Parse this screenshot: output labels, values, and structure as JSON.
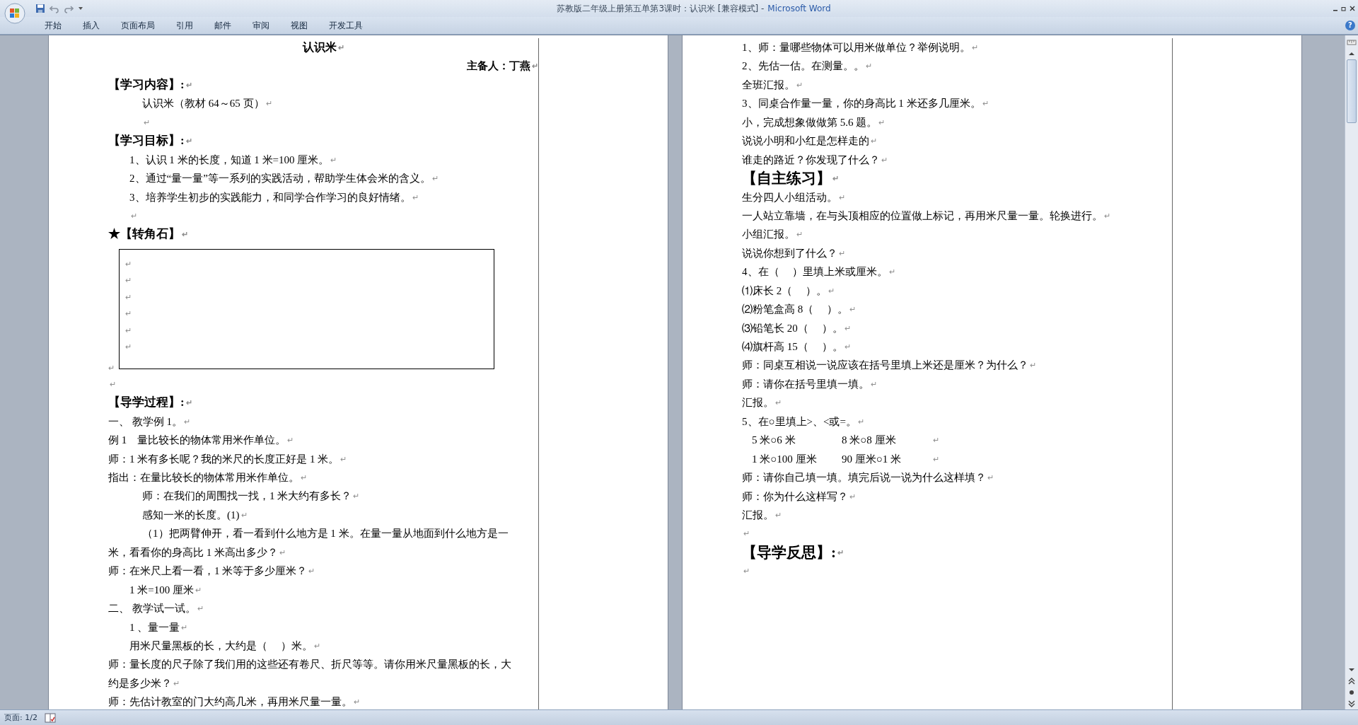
{
  "window": {
    "title": "苏教版二年级上册第五单第3课时：认识米 [兼容模式] -",
    "app": "Microsoft Word"
  },
  "ribbon_tabs": [
    {
      "label": "开始",
      "selected": false
    },
    {
      "label": "插入",
      "selected": false
    },
    {
      "label": "页面布局",
      "selected": false
    },
    {
      "label": "引用",
      "selected": false
    },
    {
      "label": "邮件",
      "selected": false
    },
    {
      "label": "审阅",
      "selected": false
    },
    {
      "label": "视图",
      "selected": false
    },
    {
      "label": "开发工具",
      "selected": false
    }
  ],
  "help": "?",
  "pages": [
    {
      "lines": [
        {
          "kind": "title",
          "text": "认识米",
          "mark": "↵"
        },
        {
          "kind": "author",
          "text": "主备人：丁燕",
          "mark": "↵"
        },
        {
          "kind": "heading",
          "text": "【学习内容】:",
          "mark": "↵"
        },
        {
          "kind": "indent",
          "text": "认识米（教材 64～65 页）",
          "mark": "↵"
        },
        {
          "kind": "indent",
          "mark": "↵"
        },
        {
          "kind": "heading",
          "text": "【学习目标】:",
          "mark": "↵"
        },
        {
          "kind": "item",
          "text": "1、认识 1 米的长度，知道 1 米=100 厘米。",
          "mark": "↵"
        },
        {
          "kind": "item",
          "text": "2、通过“量一量”等一系列的实践活动，帮助学生体会米的含义。",
          "mark": "↵"
        },
        {
          "kind": "item",
          "text": "3、培养学生初步的实践能力，和同学合作学习的良好情绪。",
          "mark": "↵"
        },
        {
          "kind": "item",
          "mark": "↵"
        },
        {
          "kind": "heading",
          "text": "★【转角石】",
          "mark": "↵"
        },
        {
          "kind": "box",
          "marks": [
            "↵",
            "↵",
            "↵",
            "↵",
            "↵",
            "↵"
          ],
          "mark": "↵"
        },
        {
          "kind": "text",
          "mark": "↵"
        },
        {
          "kind": "heading",
          "text": "【导学过程】:",
          "mark": "↵"
        },
        {
          "kind": "text",
          "text": "一、 教学例 1。",
          "mark": "↵"
        },
        {
          "kind": "text",
          "text": "例 1　量比较长的物体常用米作单位。",
          "mark": "↵"
        },
        {
          "kind": "text",
          "text": "师：1 米有多长呢？我的米尺的长度正好是 1 米。",
          "mark": "↵"
        },
        {
          "kind": "text",
          "text": "指出：在量比较长的物体常用米作单位。",
          "mark": "↵"
        },
        {
          "kind": "indent",
          "text": "师：在我们的周围找一找，1 米大约有多长？",
          "mark": "↵"
        },
        {
          "kind": "indent",
          "text": "感知一米的长度。(1)",
          "mark": "↵"
        },
        {
          "kind": "indent",
          "text": "（1）把两臂伸开，看一看到什么地方是 1 米。在量一量从地面到什么地方是一"
        },
        {
          "kind": "text",
          "text": "米，看看你的身高比 1 米高出多少？",
          "mark": "↵"
        },
        {
          "kind": "text",
          "text": "师：在米尺上看一看，1 米等于多少厘米？",
          "mark": "↵"
        },
        {
          "kind": "item",
          "text": "1 米=100 厘米",
          "mark": "↵"
        },
        {
          "kind": "text",
          "text": "二、 教学试一试。",
          "mark": "↵"
        },
        {
          "kind": "item",
          "text": "1 、量一量",
          "mark": "↵"
        },
        {
          "kind": "item",
          "text": "用米尺量黑板的长，大约是（　 ）米。",
          "mark": "↵"
        },
        {
          "kind": "text",
          "text": "师：量长度的尺子除了我们用的这些还有卷尺、折尺等等。请你用米尺量黑板的长，大"
        },
        {
          "kind": "text",
          "text": "约是多少米？",
          "mark": "↵"
        },
        {
          "kind": "text",
          "text": "师：先估计教室的门大约高几米，再用米尺量一量。",
          "mark": "↵"
        }
      ]
    },
    {
      "lines": [
        {
          "kind": "text",
          "text": "1、师：量哪些物体可以用米做单位？举例说明。",
          "mark": "↵"
        },
        {
          "kind": "text",
          "text": "2、先估一估。在测量。。",
          "mark": "↵"
        },
        {
          "kind": "text",
          "text": "全班汇报。",
          "mark": "↵"
        },
        {
          "kind": "text",
          "text": "3、同桌合作量一量，你的身高比 1 米还多几厘米。",
          "mark": "↵"
        },
        {
          "kind": "text",
          "text": "小，完成想象做做第 5.6 题。",
          "mark": "↵"
        },
        {
          "kind": "text",
          "text": "说说小明和小红是怎样走的",
          "mark": "↵"
        },
        {
          "kind": "text",
          "text": "谁走的路近？你发现了什么？",
          "mark": "↵"
        },
        {
          "kind": "big",
          "text": "【自主练习】",
          "mark": "↵"
        },
        {
          "kind": "text",
          "text": "生分四人小组活动。",
          "mark": "↵"
        },
        {
          "kind": "text",
          "text": "一人站立靠墙，在与头顶相应的位置做上标记，再用米尺量一量。轮换进行。",
          "mark": "↵"
        },
        {
          "kind": "text",
          "text": "小组汇报。",
          "mark": "↵"
        },
        {
          "kind": "text",
          "text": "说说你想到了什么？",
          "mark": "↵"
        },
        {
          "kind": "text",
          "text": "4、在（　 ）里填上米或厘米。",
          "mark": "↵"
        },
        {
          "kind": "text",
          "text": "⑴床长 2（　 ）。",
          "mark": "↵"
        },
        {
          "kind": "text",
          "text": "⑵粉笔盒高 8（　 ）。",
          "mark": "↵"
        },
        {
          "kind": "text",
          "text": "⑶铅笔长 20（　 ）。",
          "mark": "↵"
        },
        {
          "kind": "text",
          "text": "⑷旗杆高 15（　 ）。",
          "mark": "↵"
        },
        {
          "kind": "text",
          "text": "师：同桌互相说一说应该在括号里填上米还是厘米？为什么？",
          "mark": "↵"
        },
        {
          "kind": "text",
          "text": "师：请你在括号里填一填。",
          "mark": "↵"
        },
        {
          "kind": "text",
          "text": "汇报。",
          "mark": "↵"
        },
        {
          "kind": "text",
          "text": "5、在○里填上>、<或=。",
          "mark": "↵"
        },
        {
          "kind": "pair",
          "cells": [
            "5 米○6 米",
            "8 米○8 厘米"
          ],
          "mark": "↵"
        },
        {
          "kind": "pair",
          "cells": [
            "1 米○100 厘米",
            "90 厘米○1 米"
          ],
          "mark": "↵"
        },
        {
          "kind": "text",
          "text": "师：请你自己填一填。填完后说一说为什么这样填？",
          "mark": "↵"
        },
        {
          "kind": "text",
          "text": "师：你为什么这样写？",
          "mark": "↵"
        },
        {
          "kind": "text",
          "text": "汇报。",
          "mark": "↵"
        },
        {
          "kind": "text",
          "mark": "↵"
        },
        {
          "kind": "big",
          "text": "【导学反思】:",
          "mark": "↵"
        },
        {
          "kind": "text",
          "mark": "↵"
        }
      ]
    }
  ],
  "status_bar": {
    "page": "页面: 1/2"
  }
}
